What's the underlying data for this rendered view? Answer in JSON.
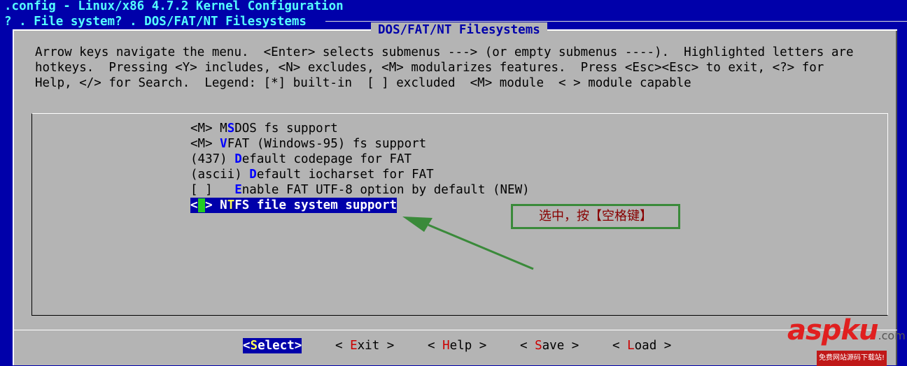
{
  "header": {
    "title": ".config - Linux/x86 4.7.2 Kernel Configuration",
    "breadcrumb": "? . File system? . DOS/FAT/NT Filesystems"
  },
  "dialog": {
    "title": "DOS/FAT/NT Filesystems",
    "help_lines": [
      "Arrow keys navigate the menu.  <Enter> selects submenus ---> (or empty submenus ----).  Highlighted letters are",
      "hotkeys.  Pressing <Y> includes, <N> excludes, <M> modularizes features.  Press <Esc><Esc> to exit, <?> for",
      "Help, </> for Search.  Legend: [*] built-in  [ ] excluded  <M> module  < > module capable"
    ]
  },
  "menu": {
    "items": [
      {
        "prefix": "<M> M",
        "hotkey": "S",
        "rest": "DOS fs support"
      },
      {
        "prefix": "<M> ",
        "hotkey": "V",
        "rest": "FAT (Windows-95) fs support"
      },
      {
        "prefix": "(437) ",
        "hotkey": "D",
        "rest": "efault codepage for FAT"
      },
      {
        "prefix": "(ascii) ",
        "hotkey": "D",
        "rest": "efault iocharset for FAT"
      },
      {
        "prefix": "[ ]   ",
        "hotkey": "E",
        "rest": "nable FAT UTF-8 option by default (NEW)"
      },
      {
        "prefix_open": "<",
        "prefix_close": "> N",
        "hotkey": "T",
        "rest": "FS file system support"
      }
    ]
  },
  "buttons": {
    "select": {
      "pre": "<",
      "hot": "S",
      "post": "elect>"
    },
    "exit": {
      "pre": "< ",
      "hot": "E",
      "post": "xit >"
    },
    "help": {
      "pre": "< ",
      "hot": "H",
      "post": "elp >"
    },
    "save": {
      "pre": "< ",
      "hot": "S",
      "post": "ave >"
    },
    "load": {
      "pre": "< ",
      "hot": "L",
      "post": "oad >"
    }
  },
  "annotation": {
    "text": "选中，按【空格键】",
    "color": "#3A8A3A"
  },
  "watermark": {
    "text": "aspku",
    "suffix": ".com",
    "subtitle": "免费网站源码下载站!"
  },
  "colors": {
    "background": "#0000AA",
    "dialog": "#B4B4B4",
    "hotkey": "#0000FF",
    "selection": "#0000AA",
    "cursor": "#22CC22"
  }
}
